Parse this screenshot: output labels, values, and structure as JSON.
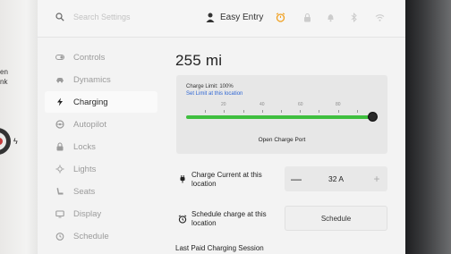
{
  "left_edge": {
    "fragment_1": "en",
    "fragment_2": "nk"
  },
  "topbar": {
    "search_placeholder": "Search Settings",
    "profile_name": "Easy Entry",
    "icons": [
      "search-icon",
      "profile-icon",
      "alarm-icon",
      "lock-icon",
      "bell-icon",
      "bluetooth-icon",
      "wifi-icon"
    ]
  },
  "sidebar": {
    "items": [
      {
        "label": "Controls",
        "icon": "toggle-icon",
        "active": false
      },
      {
        "label": "Dynamics",
        "icon": "car-icon",
        "active": false
      },
      {
        "label": "Charging",
        "icon": "bolt-icon",
        "active": true
      },
      {
        "label": "Autopilot",
        "icon": "steering-wheel-icon",
        "active": false
      },
      {
        "label": "Locks",
        "icon": "lock-icon",
        "active": false
      },
      {
        "label": "Lights",
        "icon": "light-icon",
        "active": false
      },
      {
        "label": "Seats",
        "icon": "seat-icon",
        "active": false
      },
      {
        "label": "Display",
        "icon": "display-icon",
        "active": false
      },
      {
        "label": "Schedule",
        "icon": "clock-icon",
        "active": false
      }
    ]
  },
  "charging": {
    "range": "255 mi",
    "charge_limit_label": "Charge Limit: 100%",
    "set_limit_link": "Set Limit at this location",
    "slider_ticks": [
      "20",
      "40",
      "60",
      "80"
    ],
    "charge_limit_fraction": 1.0,
    "open_port_button": "Open Charge Port",
    "charge_current_label": "Charge Current at this location",
    "charge_current_value": "32  A",
    "minus": "—",
    "plus": "+",
    "schedule_label": "Schedule charge at this location",
    "schedule_button": "Schedule",
    "last_paid_label": "Last Paid Charging Session"
  },
  "colors": {
    "accent_green": "#3fbf3f",
    "link_blue": "#2f67d4",
    "alarm_orange": "#f0a020"
  }
}
